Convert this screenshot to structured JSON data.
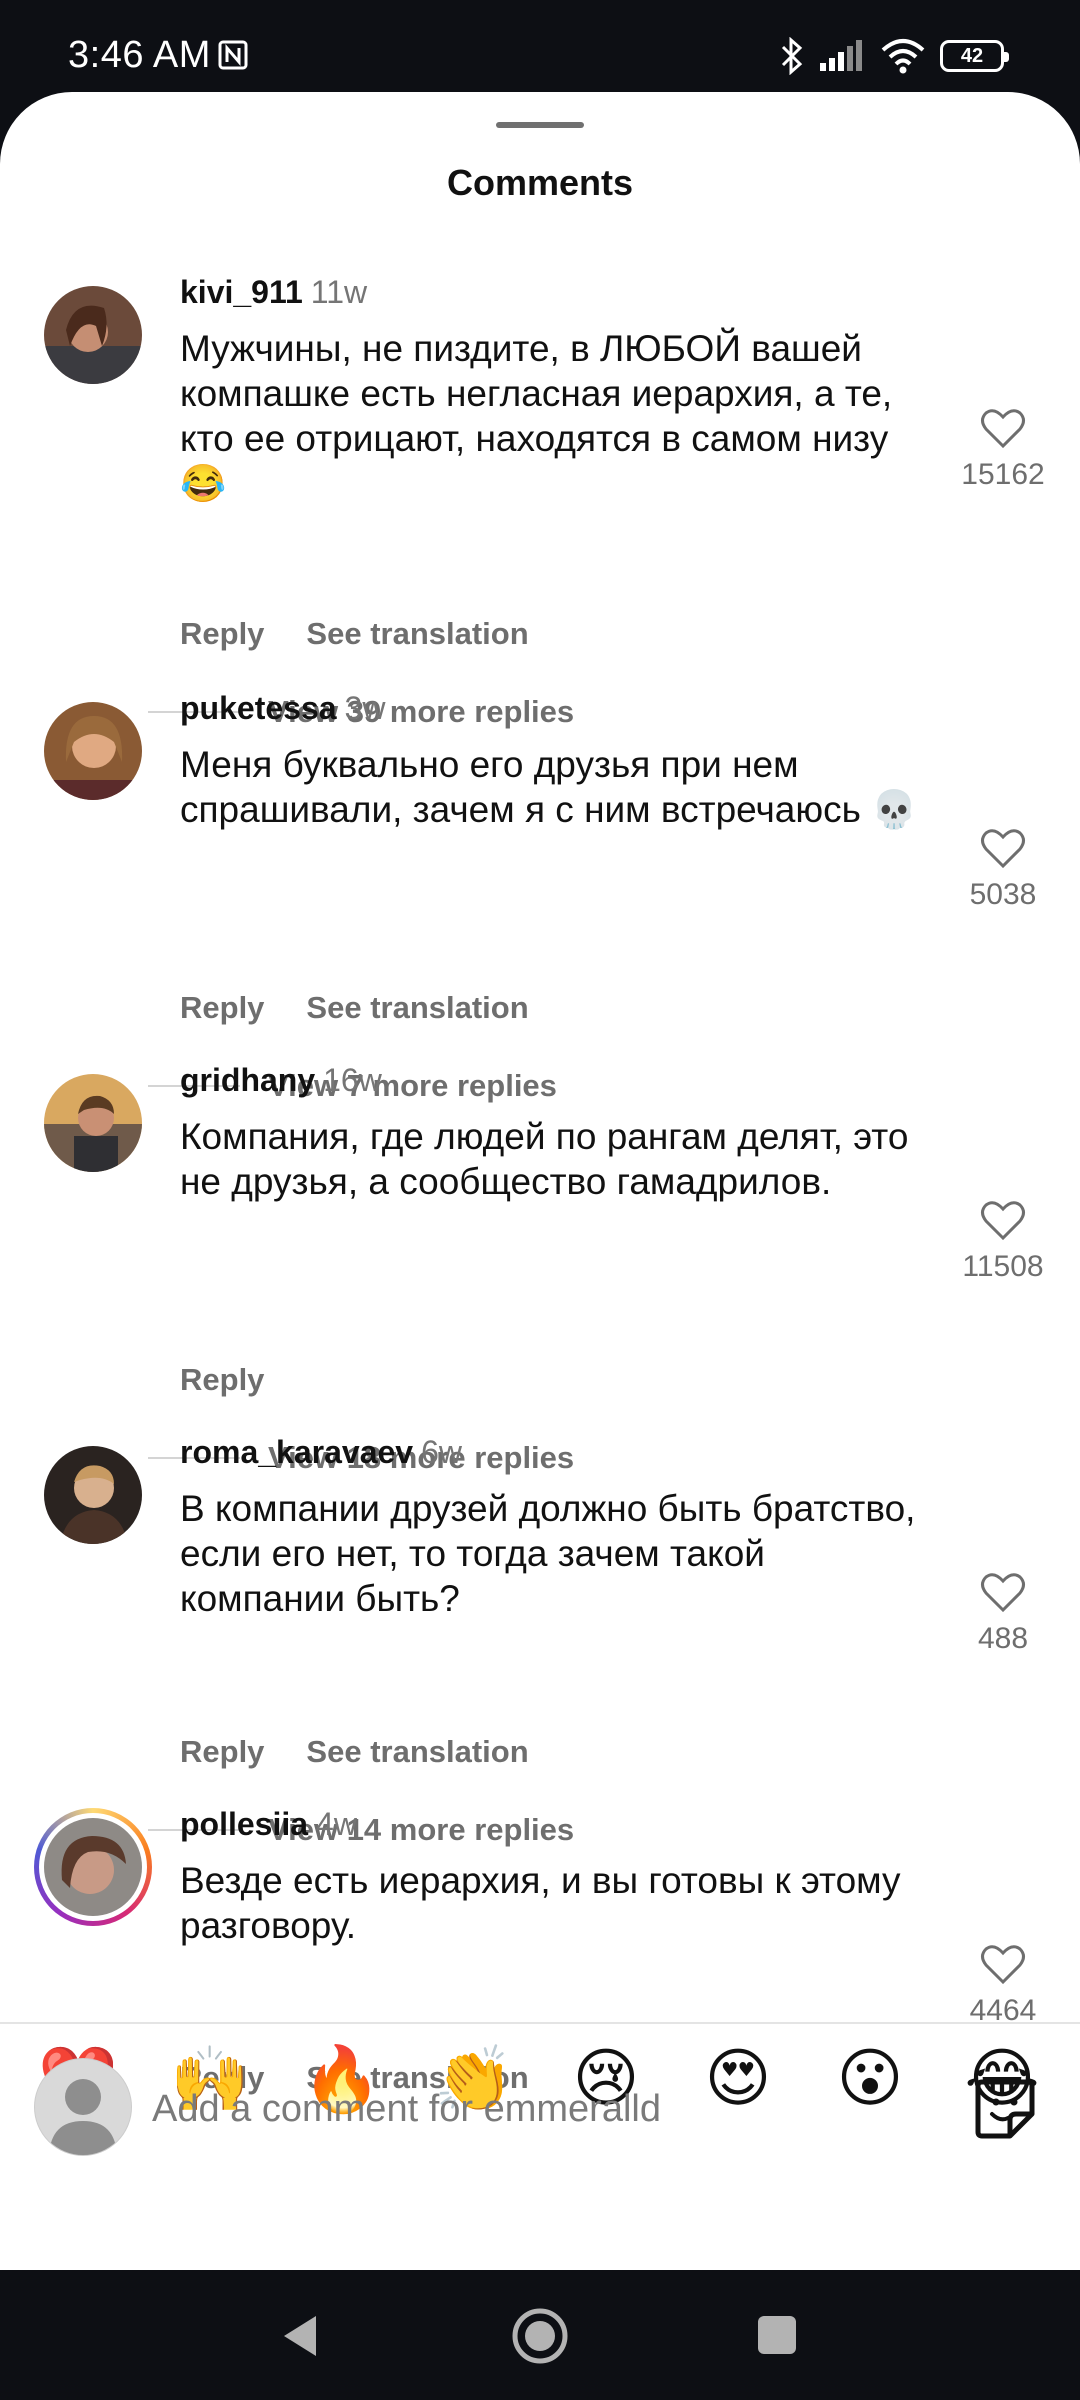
{
  "status_bar": {
    "time": "3:46 AM",
    "battery": "42"
  },
  "sheet": {
    "title": "Comments"
  },
  "comments": [
    {
      "username": "kivi_911",
      "time": "11w",
      "text": "Мужчины, не пиздите, в ЛЮБОЙ вашей компашке есть негласная иерархия, а те, кто ее отрицают, находятся в самом низу😂",
      "likes": "15162",
      "reply_label": "Reply",
      "translate_label": "See translation",
      "view_replies": "View 39 more replies"
    },
    {
      "username": "puketessa",
      "time": "3w",
      "text": "Меня буквально его друзья при нем спрашивали, зачем я с ним встречаюсь 💀",
      "likes": "5038",
      "reply_label": "Reply",
      "translate_label": "See translation",
      "view_replies": "View 7 more replies"
    },
    {
      "username": "gridhany",
      "time": "16w",
      "text": "Компания, где людей по рангам делят, это не друзья, а сообщество гамадрилов.",
      "likes": "11508",
      "reply_label": "Reply",
      "view_replies": "View 18 more replies"
    },
    {
      "username": "roma_karavaev",
      "time": "6w",
      "text": "В компании друзей должно быть братство, если его нет, то тогда зачем такой компании быть?",
      "likes": "488",
      "reply_label": "Reply",
      "translate_label": "See translation",
      "view_replies": "View 14 more replies"
    },
    {
      "username": "pollesiia",
      "time": "4w",
      "text": "Везде есть иерархия, и вы готовы к этому разговору.",
      "likes": "4464",
      "reply_label": "Reply",
      "translate_label": "See translation"
    }
  ],
  "emoji_bar": [
    "❤️",
    "🙌",
    "🔥",
    "👏",
    "😢",
    "😍",
    "😮",
    "😂"
  ],
  "composer": {
    "placeholder": "Add a comment for emmeralld"
  },
  "icons": {
    "status": [
      "nfc-icon",
      "bluetooth-icon",
      "signal-icon",
      "wifi-icon",
      "battery-icon"
    ],
    "nav": [
      "back-icon",
      "home-icon",
      "recents-icon"
    ],
    "composer": [
      "sticker-icon"
    ]
  },
  "colors": {
    "accent_story_ring": "#d62976",
    "secondary_text": "#6e6e6e"
  }
}
